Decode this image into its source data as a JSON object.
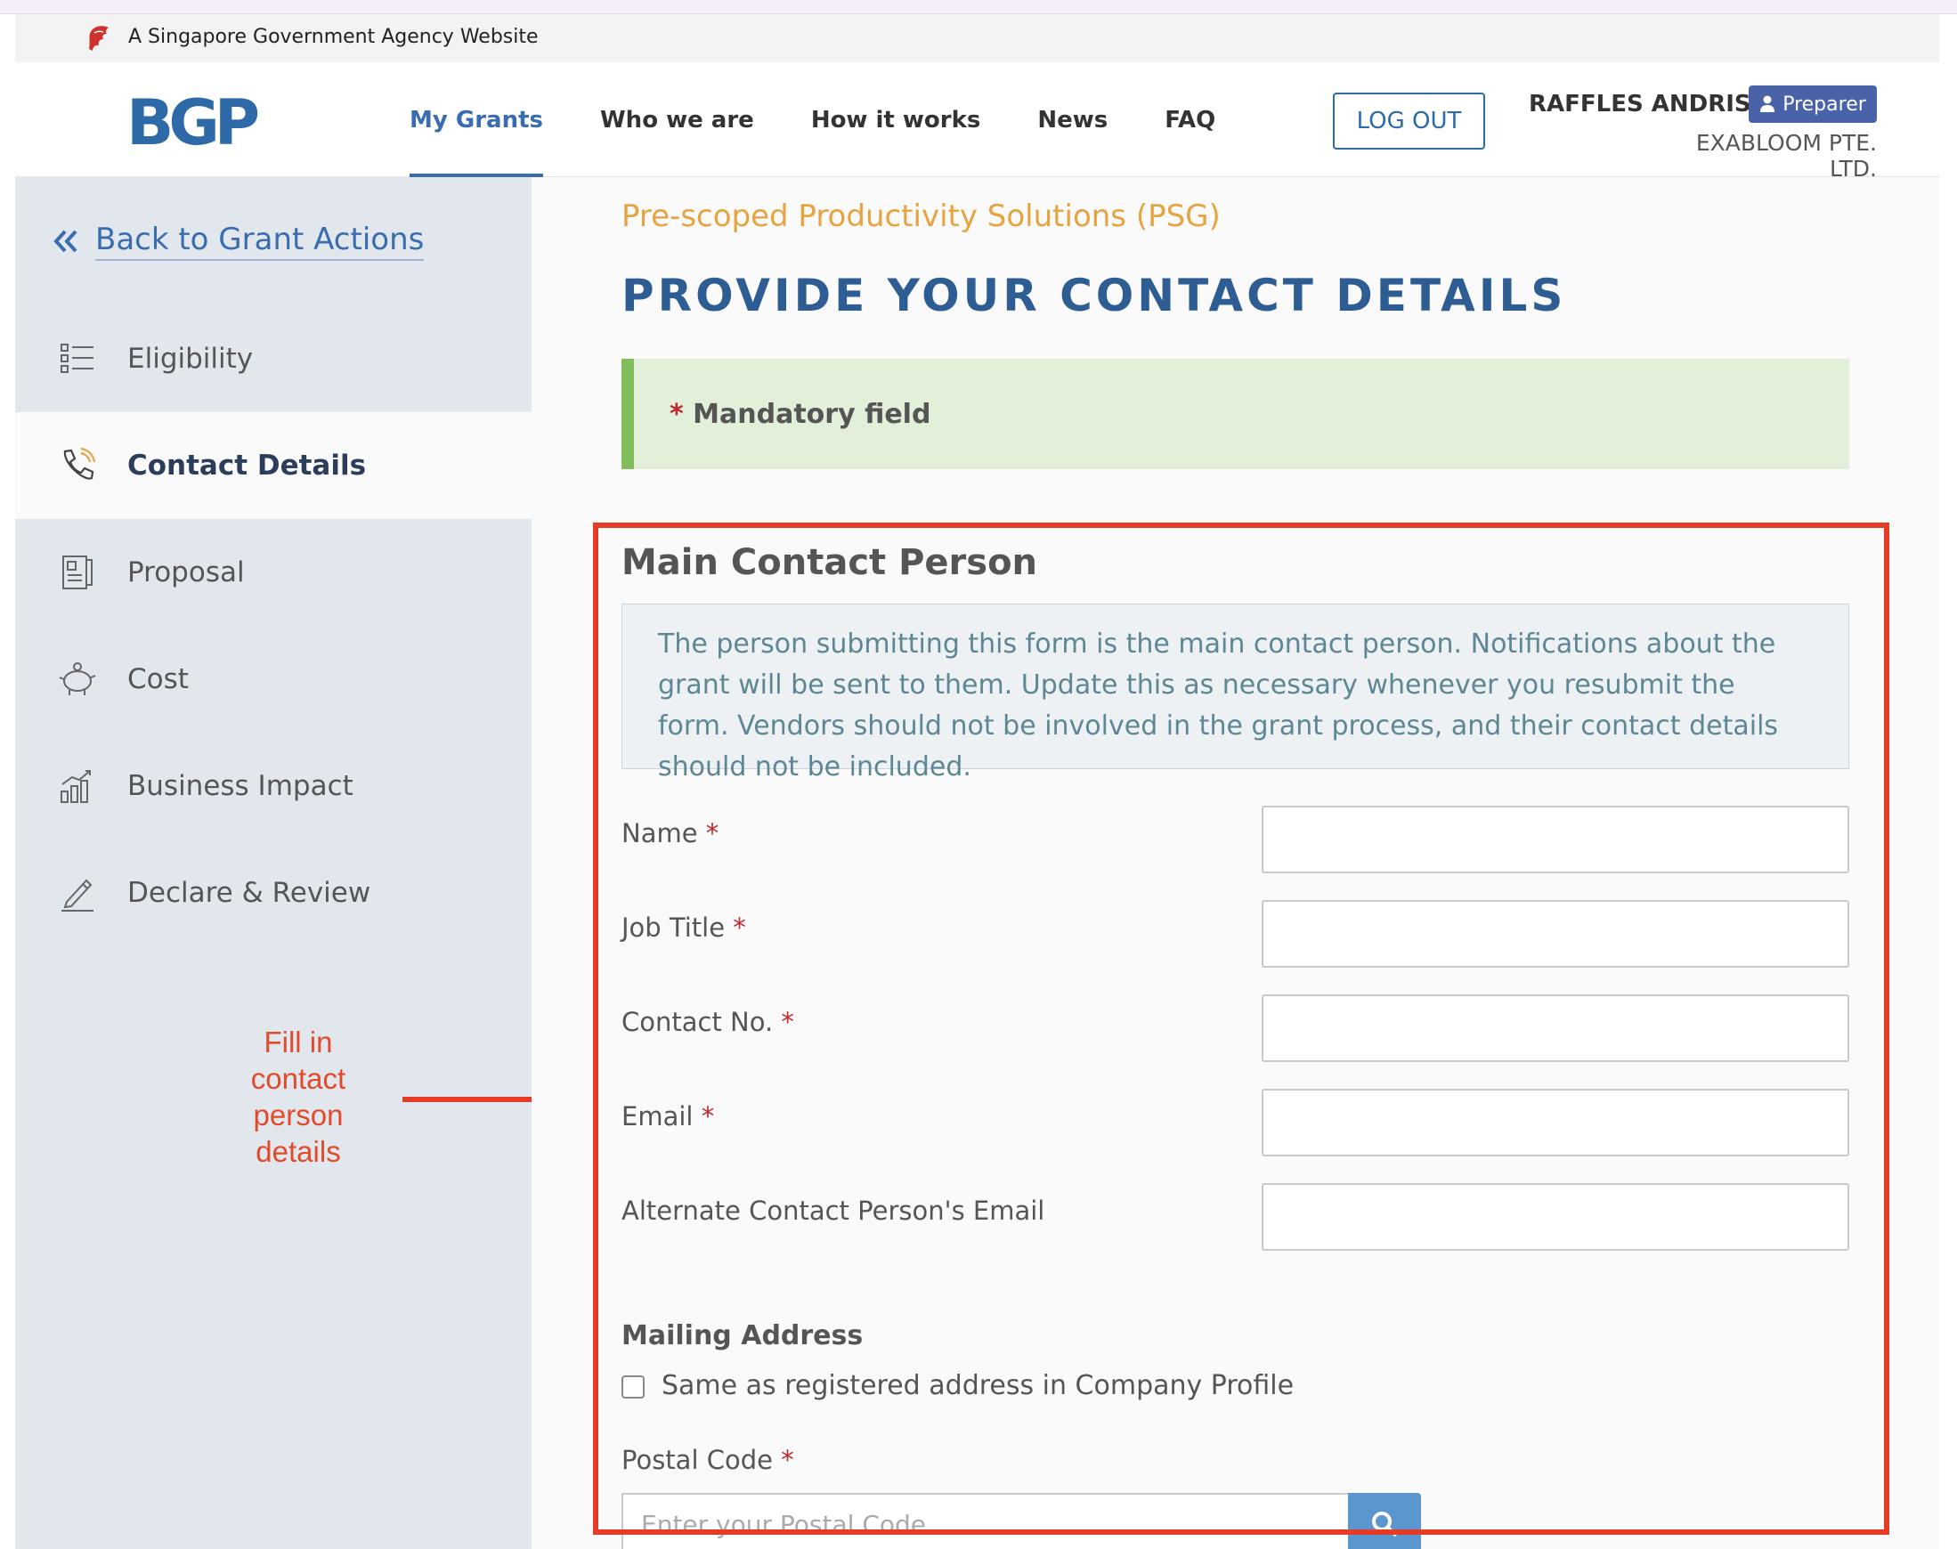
{
  "masthead": {
    "text": "A Singapore Government Agency Website",
    "brand_color": "#d0312d"
  },
  "header": {
    "logo": "BGP",
    "nav": [
      {
        "label": "My Grants",
        "active": true
      },
      {
        "label": "Who we are"
      },
      {
        "label": "How it works"
      },
      {
        "label": "News"
      },
      {
        "label": "FAQ"
      }
    ],
    "logout_label": "LOG OUT",
    "user_name": "RAFFLES ANDRISON",
    "role": "Preparer",
    "company": "EXABLOOM PTE. LTD."
  },
  "sidebar": {
    "back_label": "Back to Grant Actions",
    "items": [
      {
        "label": "Eligibility",
        "icon": "list-icon"
      },
      {
        "label": "Contact Details",
        "icon": "phone-icon",
        "active": true
      },
      {
        "label": "Proposal",
        "icon": "document-icon"
      },
      {
        "label": "Cost",
        "icon": "piggy-bank-icon"
      },
      {
        "label": "Business Impact",
        "icon": "bar-chart-icon"
      },
      {
        "label": "Declare & Review",
        "icon": "pen-icon"
      }
    ]
  },
  "annotation": {
    "text": "Fill in contact person details",
    "color": "#e24a2a"
  },
  "main": {
    "program": "Pre-scoped Productivity Solutions (PSG)",
    "title": "PROVIDE YOUR CONTACT DETAILS",
    "mandatory": "Mandatory field",
    "section_title": "Main Contact Person",
    "info": "The person submitting this form is the main contact person. Notifications about the grant will be sent to them. Update this as necessary whenever you resubmit the form. Vendors should not be involved in the grant process, and their contact details should not be included.",
    "fields": [
      {
        "label": "Name",
        "required": true,
        "value": ""
      },
      {
        "label": "Job Title",
        "required": true,
        "value": ""
      },
      {
        "label": "Contact No.",
        "required": true,
        "value": ""
      },
      {
        "label": "Email",
        "required": true,
        "value": ""
      },
      {
        "label": "Alternate Contact Person's Email",
        "required": false,
        "value": ""
      }
    ],
    "mailing_heading": "Mailing Address",
    "same_address_label": "Same as registered address in Company Profile",
    "postal_label": "Postal Code",
    "postal_placeholder": "Enter your Postal Code"
  },
  "colors": {
    "accent": "#3a6db0",
    "program": "#e8a341",
    "highlight": "#e43c25"
  }
}
